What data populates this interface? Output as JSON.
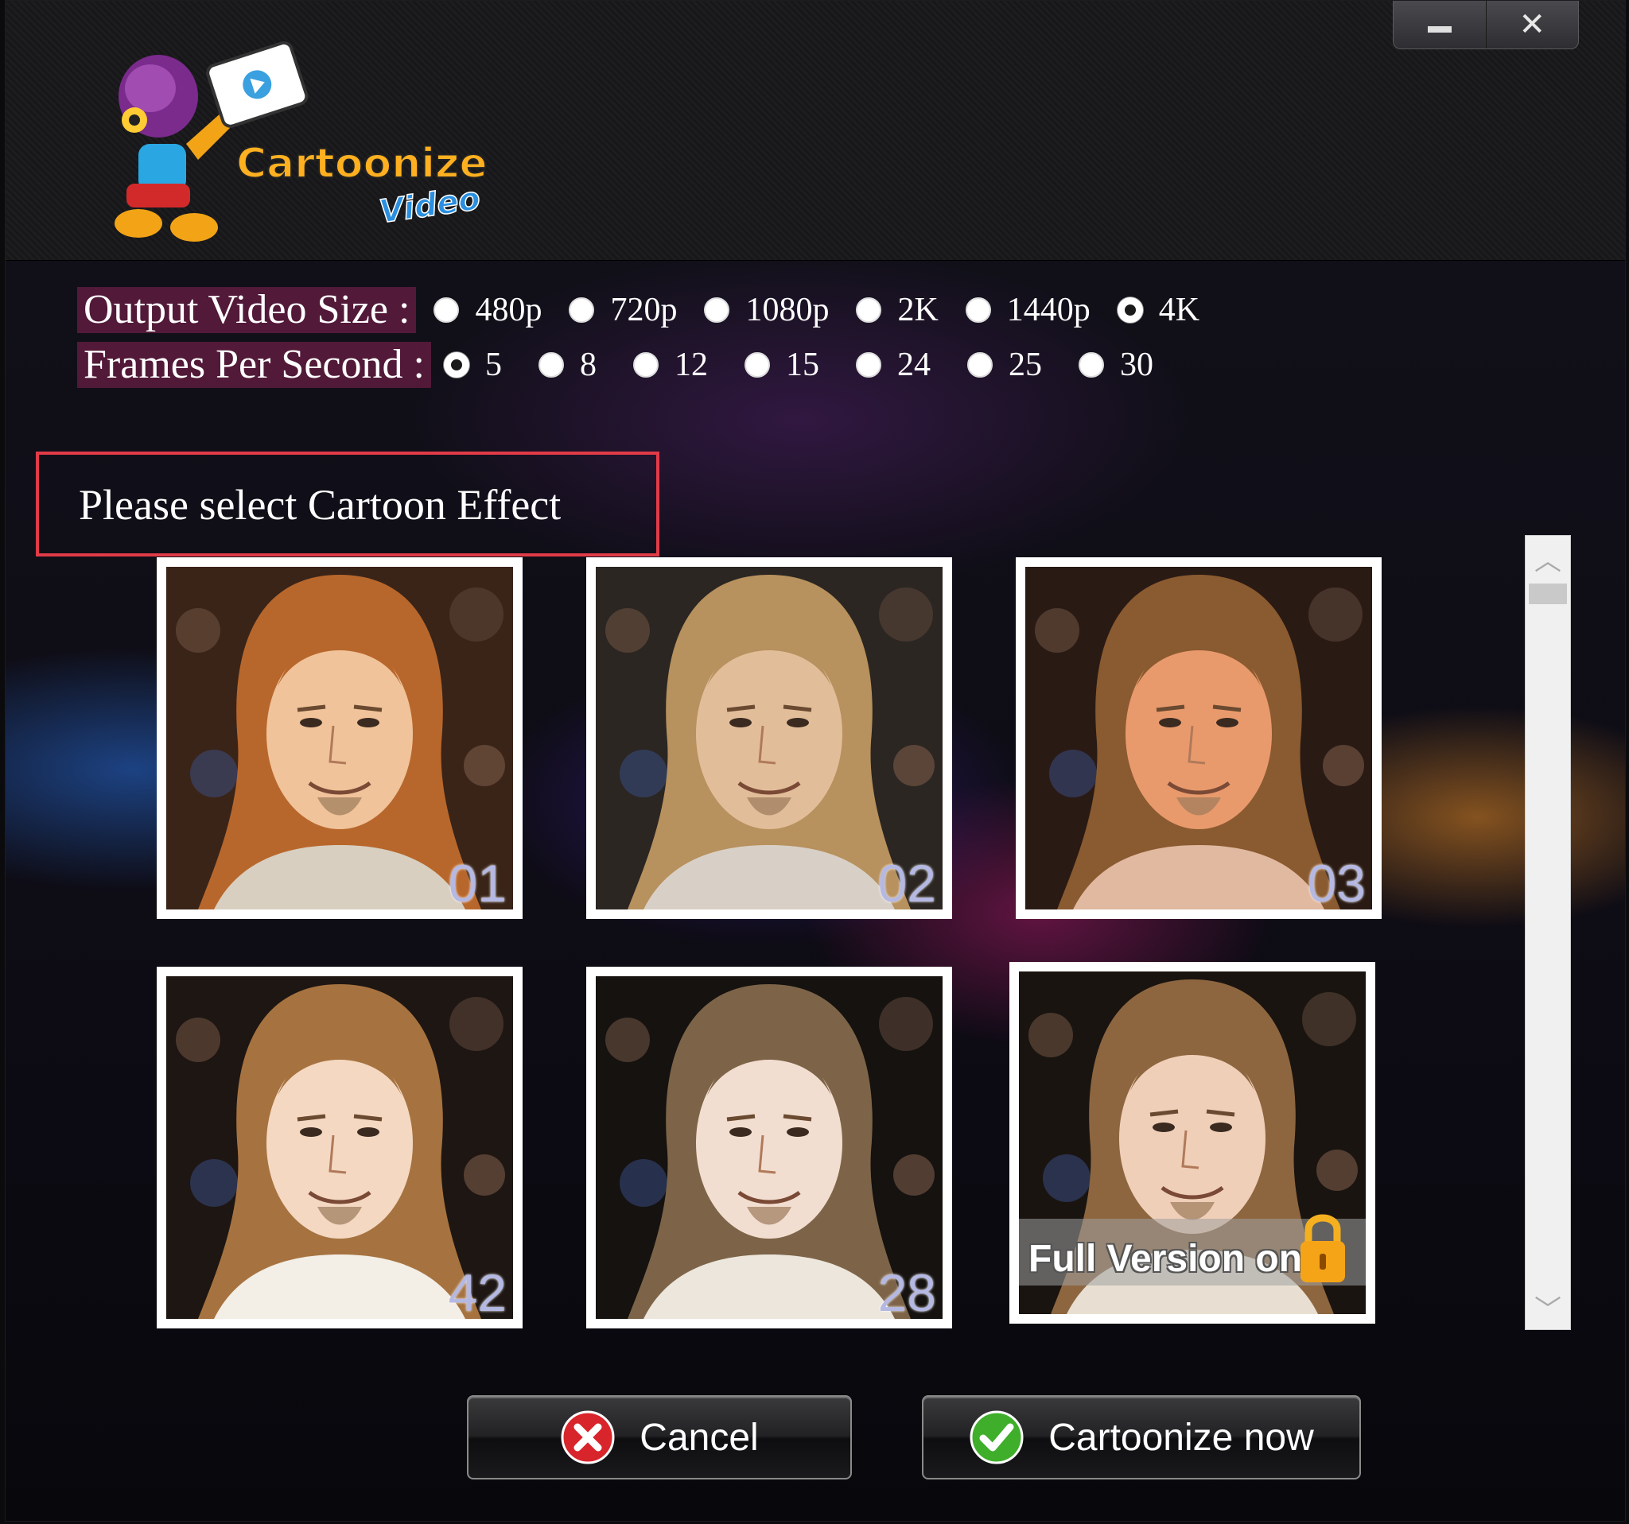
{
  "app": {
    "logo_word1": "Cartoonize",
    "logo_word2": "Video"
  },
  "window_controls": {
    "minimize_icon": "minimize-icon",
    "close_icon": "close-icon",
    "close_glyph": "✕"
  },
  "output_size": {
    "label": "Output Video Size :",
    "options": [
      {
        "label": "480p",
        "checked": false
      },
      {
        "label": "720p",
        "checked": false
      },
      {
        "label": "1080p",
        "checked": false
      },
      {
        "label": "2K",
        "checked": false
      },
      {
        "label": "1440p",
        "checked": false
      },
      {
        "label": "4K",
        "checked": true
      }
    ]
  },
  "fps": {
    "label": "Frames Per Second :",
    "options": [
      {
        "label": "5",
        "checked": true
      },
      {
        "label": "8",
        "checked": false
      },
      {
        "label": "12",
        "checked": false
      },
      {
        "label": "15",
        "checked": false
      },
      {
        "label": "24",
        "checked": false
      },
      {
        "label": "25",
        "checked": false
      },
      {
        "label": "30",
        "checked": false
      }
    ]
  },
  "effects": {
    "prompt": "Please select Cartoon Effect",
    "items": [
      {
        "number": "01",
        "locked": false
      },
      {
        "number": "02",
        "locked": false
      },
      {
        "number": "03",
        "locked": false
      },
      {
        "number": "42",
        "locked": false
      },
      {
        "number": "28",
        "locked": false
      },
      {
        "number": "",
        "locked": true,
        "locked_text": "Full Version only"
      }
    ]
  },
  "scroll": {
    "up_glyph": "︿",
    "down_glyph": "﹀"
  },
  "buttons": {
    "cancel": "Cancel",
    "cartoonize": "Cartoonize now"
  },
  "colors": {
    "accent_red": "#e23b48",
    "cancel_icon": "#d8252b",
    "ok_icon": "#3fae2a",
    "label_bg": "#6e1e46"
  }
}
